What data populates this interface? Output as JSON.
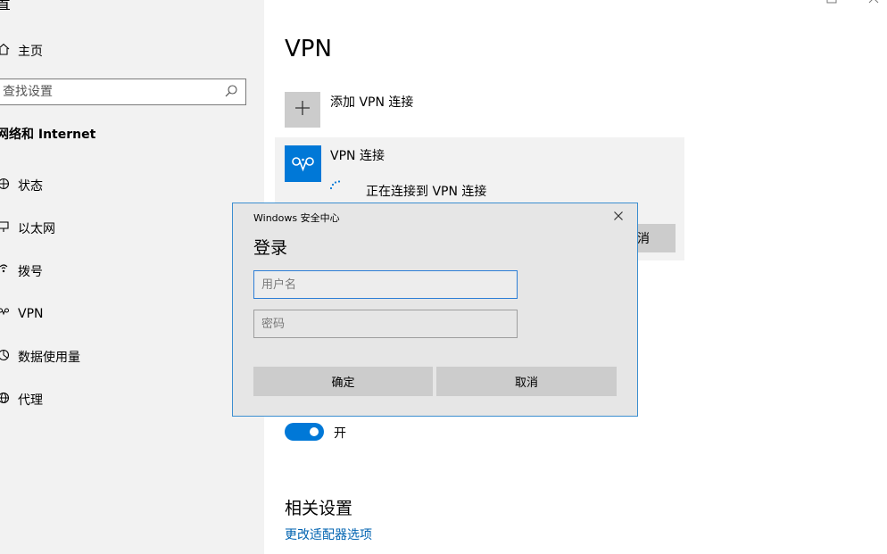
{
  "sidebar": {
    "title": "置",
    "home": {
      "icon": "home-icon",
      "label": "主页"
    },
    "search": {
      "placeholder": "查找设置",
      "icon": "search-icon"
    },
    "section_title": "网络和 Internet",
    "items": [
      {
        "icon": "globe-icon",
        "label": "状态"
      },
      {
        "icon": "ethernet-icon",
        "label": "以太网"
      },
      {
        "icon": "dialup-icon",
        "label": "拨号"
      },
      {
        "icon": "vpn-icon",
        "label": "VPN"
      },
      {
        "icon": "data-usage-icon",
        "label": "数据使用量"
      },
      {
        "icon": "proxy-icon",
        "label": "代理"
      }
    ]
  },
  "main": {
    "title": "VPN",
    "add_label": "添加 VPN 连接",
    "connection": {
      "name": "VPN 连接",
      "status": "正在连接到 VPN 连接",
      "cancel_partial": "消"
    },
    "toggle": {
      "state": "on",
      "label": "开"
    },
    "related": {
      "title": "相关设置",
      "link": "更改适配器选项"
    }
  },
  "dialog": {
    "caption": "Windows 安全中心",
    "title": "登录",
    "username_placeholder": "用户名",
    "password_placeholder": "密码",
    "ok_label": "确定",
    "cancel_label": "取消"
  },
  "colors": {
    "accent": "#0078d7",
    "link": "#0063b1",
    "sidebar_bg": "#f2f2f2",
    "dialog_bg": "#e6e6e6",
    "dialog_border": "#3b8ed0"
  }
}
